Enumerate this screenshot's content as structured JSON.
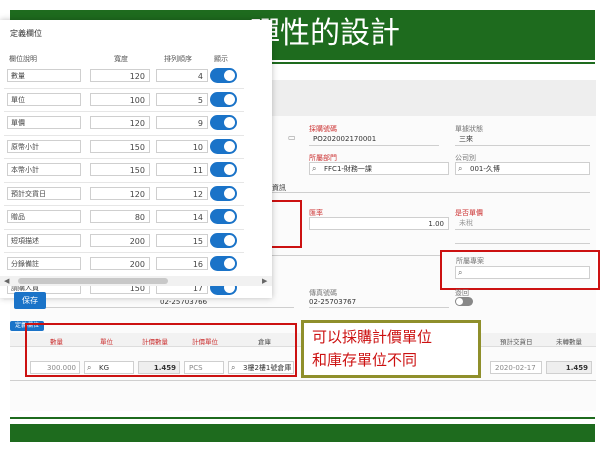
{
  "slide": {
    "title": "彈性的設計",
    "callout_line1": "可以採購計價單位",
    "callout_line2": "和庫存單位不同"
  },
  "dialog": {
    "title": "定義欄位",
    "headers": {
      "name": "欄位說明",
      "width": "寬度",
      "order": "排列順序",
      "show": "顯示"
    },
    "rows": [
      {
        "name": "數量",
        "width": "120",
        "order": "4",
        "show": true
      },
      {
        "name": "單位",
        "width": "100",
        "order": "5",
        "show": true
      },
      {
        "name": "單價",
        "width": "120",
        "order": "9",
        "show": true
      },
      {
        "name": "原幣小計",
        "width": "150",
        "order": "10",
        "show": true
      },
      {
        "name": "本幣小計",
        "width": "150",
        "order": "11",
        "show": true
      },
      {
        "name": "預計交貨日",
        "width": "120",
        "order": "12",
        "show": true
      },
      {
        "name": "贈品",
        "width": "80",
        "order": "14",
        "show": true
      },
      {
        "name": "短項描述",
        "width": "200",
        "order": "15",
        "show": true
      },
      {
        "name": "分錄備註",
        "width": "200",
        "order": "16",
        "show": true
      },
      {
        "name": "請購人員",
        "width": "150",
        "order": "17",
        "show": true
      }
    ],
    "save_label": "保存"
  },
  "form": {
    "order_no_label": "採購號碼",
    "order_no_value": "PO202002170001",
    "doc_status_label": "單據狀態",
    "doc_status_value": "三來",
    "dept_label": "所屬部門",
    "dept_value": "FFC1-財務一課",
    "company_label": "公司別",
    "company_value": "001-久博",
    "tab_label": "資訊",
    "currency_label": "匯率",
    "currency_value": "1.00",
    "tax_label": "是否單價",
    "tax_value": "未稅",
    "project_label": "所屬專案",
    "fax_label": "傳真號碼",
    "fax_value": "02-25703767",
    "phone_value": "02-25703766",
    "closed_label": "簽回"
  },
  "grid": {
    "button_label": "定義欄位",
    "headers": {
      "qty": "數量",
      "unit": "單位",
      "price_qty": "計價數量",
      "price_unit": "計價單位",
      "warehouse": "倉庫",
      "delivery": "預計交貨日",
      "undelivered": "未轉數量"
    },
    "row": {
      "qty": "300.000",
      "unit": "KG",
      "price_qty": "1.459",
      "price_unit": "PCS",
      "warehouse": "3樓2樓1號倉庫",
      "delivery": "2020-02-17",
      "undelivered": "1.459"
    }
  },
  "icons": [
    "search-icon",
    "calendar-icon",
    "chevron-left-icon",
    "chevron-right-icon"
  ],
  "colors": {
    "slide_green": "#1e6b1e",
    "accent_blue": "#1a73c8",
    "highlight_red": "#cc1111",
    "callout_border": "#8f8f2b"
  }
}
